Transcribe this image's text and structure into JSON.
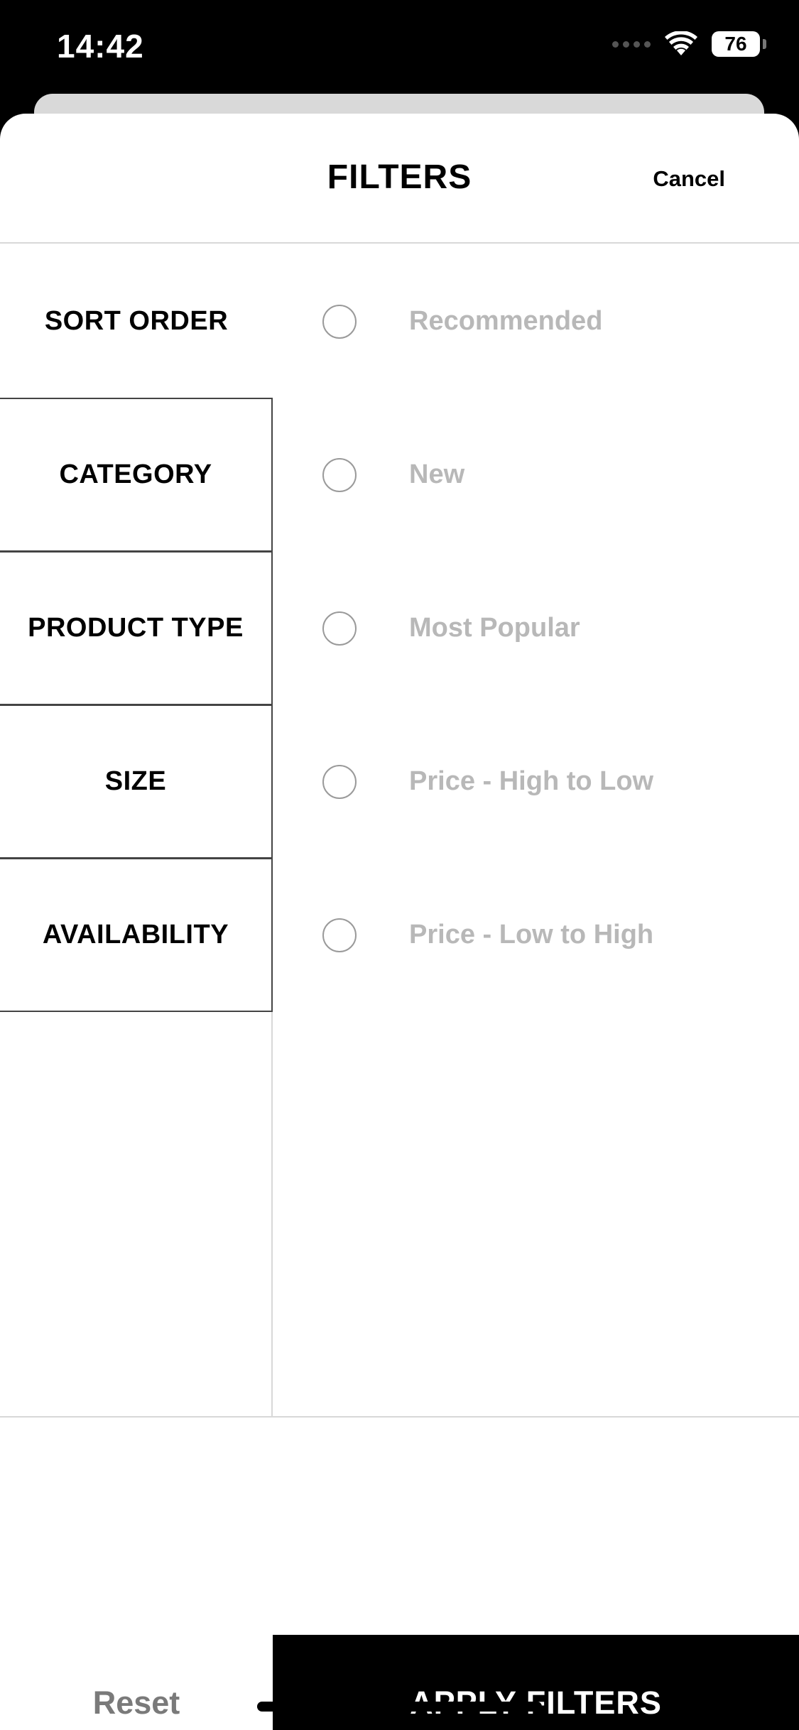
{
  "status_bar": {
    "time": "14:42",
    "battery": "76",
    "battery_level": 0.76,
    "icons": [
      "signal-icon",
      "wifi-icon",
      "battery-icon"
    ]
  },
  "header": {
    "title": "FILTERS",
    "cancel_label": "Cancel"
  },
  "tabs": [
    {
      "label": "SORT ORDER",
      "active": true
    },
    {
      "label": "CATEGORY",
      "active": false
    },
    {
      "label": "PRODUCT TYPE",
      "active": false
    },
    {
      "label": "SIZE",
      "active": false
    },
    {
      "label": "AVAILABILITY",
      "active": false
    }
  ],
  "sort_options": [
    {
      "label": "Recommended",
      "selected": false
    },
    {
      "label": "New",
      "selected": false
    },
    {
      "label": "Most Popular",
      "selected": false
    },
    {
      "label": "Price - High to Low",
      "selected": false
    },
    {
      "label": "Price - Low to High",
      "selected": false
    }
  ],
  "footer": {
    "reset_label": "Reset",
    "apply_label": "APPLY FILTERS"
  },
  "colors": {
    "accent": "#000000",
    "muted_text": "#b8b8b8",
    "reset_text": "#7a7a7a",
    "divider": "#d8d8d8"
  }
}
